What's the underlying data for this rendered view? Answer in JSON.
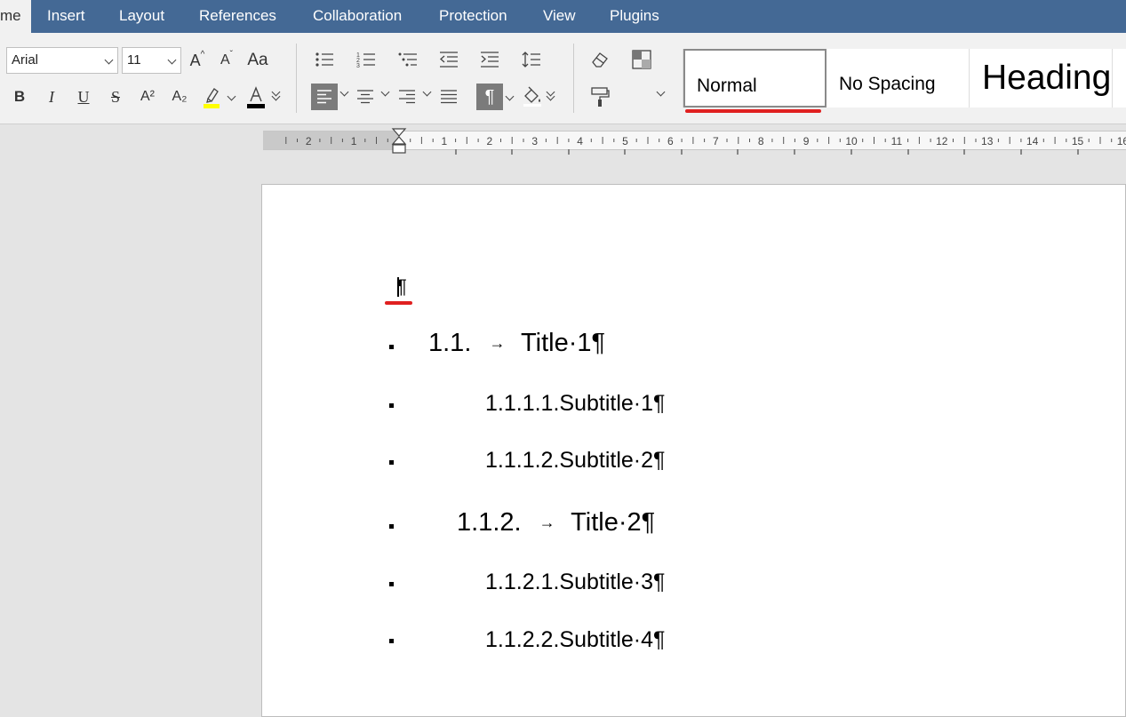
{
  "menu": {
    "tabs": [
      {
        "label": "me",
        "active": true
      },
      {
        "label": "Insert"
      },
      {
        "label": "Layout"
      },
      {
        "label": "References"
      },
      {
        "label": "Collaboration"
      },
      {
        "label": "Protection"
      },
      {
        "label": "View"
      },
      {
        "label": "Plugins"
      }
    ]
  },
  "toolbar": {
    "font_name": "Arial",
    "font_size": "11",
    "bold": "B",
    "italic": "I",
    "underline": "U",
    "strikethrough": "S",
    "superscript": "A²",
    "subscript": "A₂",
    "grow_font": "A",
    "shrink_font": "A",
    "change_case": "Aa",
    "highlight_color": "#ffff00",
    "font_color": "#000000",
    "paragraph_mark": "¶"
  },
  "styles": {
    "normal": "Normal",
    "no_spacing": "No Spacing",
    "heading": "Heading"
  },
  "ruler": {
    "numbers": [
      "2",
      "1",
      "1",
      "2",
      "3",
      "4",
      "5",
      "6",
      "7",
      "8",
      "9",
      "10",
      "11",
      "12",
      "13",
      "14",
      "15",
      "16"
    ]
  },
  "document": {
    "empty_paragraph": "¶",
    "lines": [
      {
        "number": "1.1.",
        "tab": "→",
        "text": "Title·1¶",
        "level": "title"
      },
      {
        "number": "1.1.1.1.",
        "text": "Subtitle·1¶",
        "level": "subtitle"
      },
      {
        "number": "1.1.1.2.",
        "text": "Subtitle·2¶",
        "level": "subtitle"
      },
      {
        "number": "1.1.2.",
        "tab": "→",
        "text": "Title·2¶",
        "level": "title"
      },
      {
        "number": "1.1.2.1.",
        "text": "Subtitle·3¶",
        "level": "subtitle"
      },
      {
        "number": "1.1.2.2.",
        "text": "Subtitle·4¶",
        "level": "subtitle"
      }
    ]
  },
  "colors": {
    "menubar": "#446995",
    "annotation_underline": "#e02020"
  }
}
